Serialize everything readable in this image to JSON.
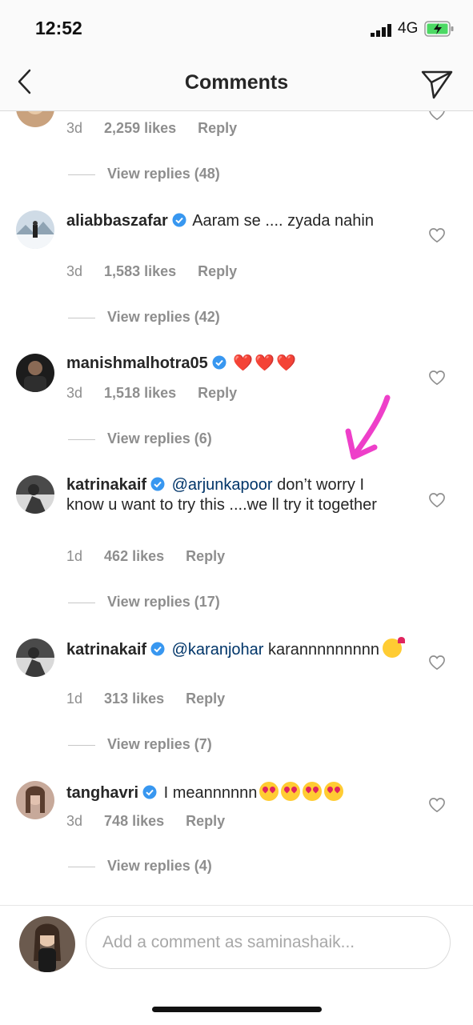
{
  "status_bar": {
    "time": "12:52",
    "network": "4G"
  },
  "header": {
    "title": "Comments"
  },
  "top_partial": {
    "age": "3d",
    "likes": "2,259 likes",
    "reply": "Reply",
    "view_replies": "View replies (48)"
  },
  "comments": [
    {
      "username": "aliabbaszafar",
      "text": "Aaram se .... zyada nahin",
      "age": "3d",
      "likes": "1,583 likes",
      "reply": "Reply",
      "view_replies": "View replies (42)"
    },
    {
      "username": "manishmalhotra05",
      "text": "❤️❤️❤️",
      "age": "3d",
      "likes": "1,518 likes",
      "reply": "Reply",
      "view_replies": "View replies (6)"
    },
    {
      "username": "katrinakaif",
      "mention": "@arjunkapoor",
      "text": " don’t worry I know u want to try this ....we ll try it together",
      "age": "1d",
      "likes": "462 likes",
      "reply": "Reply",
      "view_replies": "View replies (17)"
    },
    {
      "username": "katrinakaif",
      "mention": "@karanjohar",
      "text": " karannnnnnnnn",
      "age": "1d",
      "likes": "313 likes",
      "reply": "Reply",
      "view_replies": "View replies (7)"
    },
    {
      "username": "tanghavri",
      "text": "I meannnnnn",
      "age": "3d",
      "likes": "748 likes",
      "reply": "Reply",
      "view_replies": "View replies (4)"
    }
  ],
  "composer": {
    "placeholder": "Add a comment as saminashaik..."
  },
  "colors": {
    "link": "#003569",
    "muted": "#8e8e8e",
    "verified": "#3897f0",
    "annotation": "#ee3fc9"
  }
}
